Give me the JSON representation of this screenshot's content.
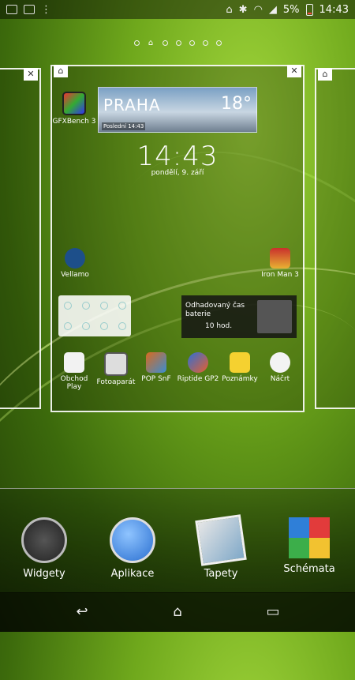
{
  "status_bar": {
    "battery": "5%",
    "time": "14:43"
  },
  "weather": {
    "city": "PRAHA",
    "temperature": "18°",
    "updated": "Poslední 14:43"
  },
  "clock": {
    "time": "14:43",
    "date": "pondělí, 9. září"
  },
  "home_apps": {
    "gfxbench": "GFXBench 3",
    "vellamo": "Vellamo",
    "ironman": "Iron Man 3"
  },
  "battery_widget": {
    "title": "Odhadovaný čas baterie",
    "hours": "10 hod."
  },
  "dock_row_apps": [
    "Obchod Play",
    "Fotoaparát",
    "POP SnF",
    "Riptide GP2",
    "Poznámky",
    "Náčrt"
  ],
  "dock": {
    "widgets": "Widgety",
    "apps": "Aplikace",
    "wallpapers": "Tapety",
    "themes": "Schémata"
  },
  "colors": {
    "accent": "#6fa81c",
    "dark": "#233f07"
  }
}
